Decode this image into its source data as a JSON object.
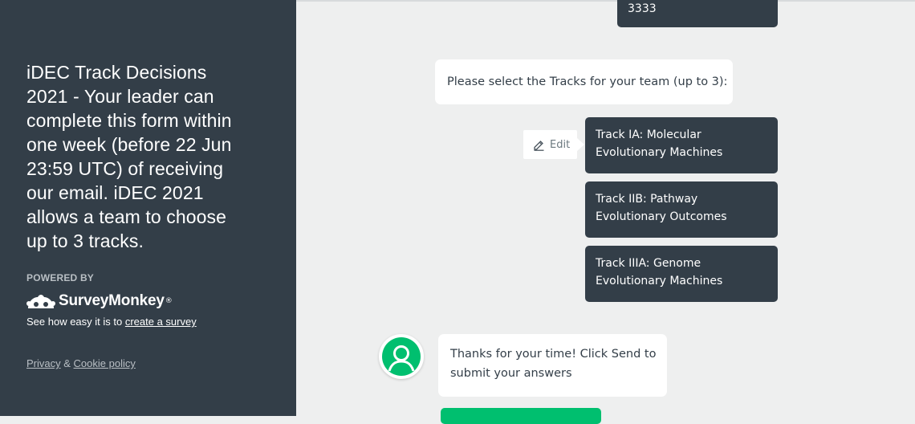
{
  "sidebar": {
    "title": "iDEC Track Decisions 2021 - Your leader can complete this form within one week (before 22 Jun 23:59 UTC) of receiving our email. iDEC 2021 allows a team to choose up to 3 tracks.",
    "powered_by": "POWERED BY",
    "brand": "SurveyMonkey",
    "brand_mark": "®",
    "see_how_prefix": "See how easy it is to ",
    "create_link": "create a survey",
    "privacy_link": "Privacy",
    "amp": " & ",
    "cookie_link": "Cookie policy"
  },
  "chat": {
    "previous_answer": "3333",
    "question": "Please select the Tracks for your team (up to 3):",
    "edit_label": "Edit",
    "answers": [
      "Track IA: Molecular Evolutionary Machines",
      "Track IIB: Pathway Evolutionary Outcomes",
      "Track IIIA: Genome Evolutionary Machines"
    ],
    "thanks": "Thanks for your time! Click Send to submit your answers"
  },
  "colors": {
    "sidebar_bg": "#333e48",
    "brand_green": "#00bf6f",
    "page_bg": "#eeefef"
  },
  "icons": {
    "edit": "pencil-icon",
    "logo": "surveymonkey-logo-icon",
    "avatar": "survey-bot-avatar-icon"
  }
}
